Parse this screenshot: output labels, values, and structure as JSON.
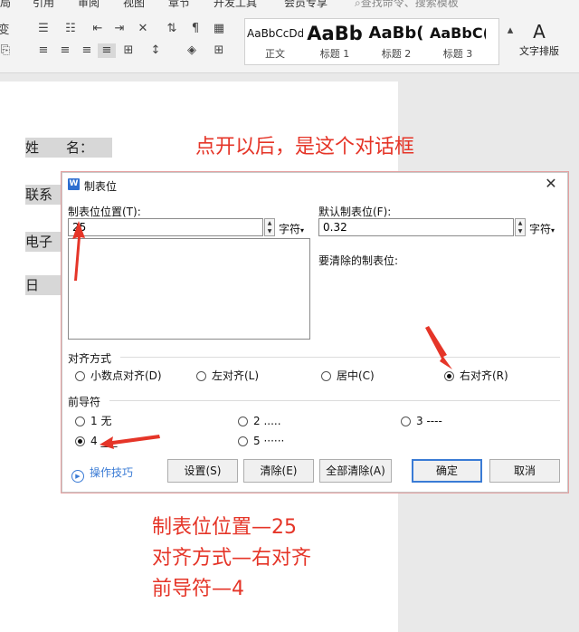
{
  "ribbon": {
    "menu": [
      "局",
      "引用",
      "审阅",
      "视图",
      "章节",
      "开发工具",
      "会员专享",
      "查找命令、搜索模板"
    ],
    "styles": [
      {
        "sample": "AaBbCcDd",
        "name": "正文"
      },
      {
        "sample": "AaBb",
        "name": "标题 1"
      },
      {
        "sample": "AaBb(",
        "name": "标题 2"
      },
      {
        "sample": "AaBbC(",
        "name": "标题 3"
      }
    ],
    "text_layout_label": "文字排版",
    "left_cut": "变"
  },
  "document": {
    "lines": [
      "姓　　名：",
      "联系",
      "电子",
      "日"
    ]
  },
  "annotations": {
    "top": "点开以后，是这个对话框",
    "bottom": [
      "制表位位置—25",
      "对齐方式—右对齐",
      "前导符—4"
    ]
  },
  "dialog": {
    "title": "制表位",
    "tab_position_label": "制表位位置(T):",
    "tab_position_value": "25",
    "default_tab_label": "默认制表位(F):",
    "default_tab_value": "0.32",
    "unit": "字符",
    "to_clear_label": "要清除的制表位:",
    "alignment_label": "对齐方式",
    "alignment_options": [
      {
        "label": "小数点对齐(D)",
        "checked": false
      },
      {
        "label": "左对齐(L)",
        "checked": false
      },
      {
        "label": "居中(C)",
        "checked": false
      },
      {
        "label": "右对齐(R)",
        "checked": true
      }
    ],
    "leader_label": "前导符",
    "leader_options": [
      {
        "label": "1 无",
        "checked": false
      },
      {
        "label": "2 .....",
        "checked": false
      },
      {
        "label": "3 ----",
        "checked": false
      },
      {
        "label": "4 ___",
        "checked": true
      },
      {
        "label": "5 ······",
        "checked": false
      }
    ],
    "tips_label": "操作技巧",
    "buttons": {
      "set": "设置(S)",
      "clear": "清除(E)",
      "clear_all": "全部清除(A)",
      "ok": "确定",
      "cancel": "取消"
    }
  },
  "colors": {
    "annotation": "#e53528",
    "accent": "#3a7bd5"
  }
}
